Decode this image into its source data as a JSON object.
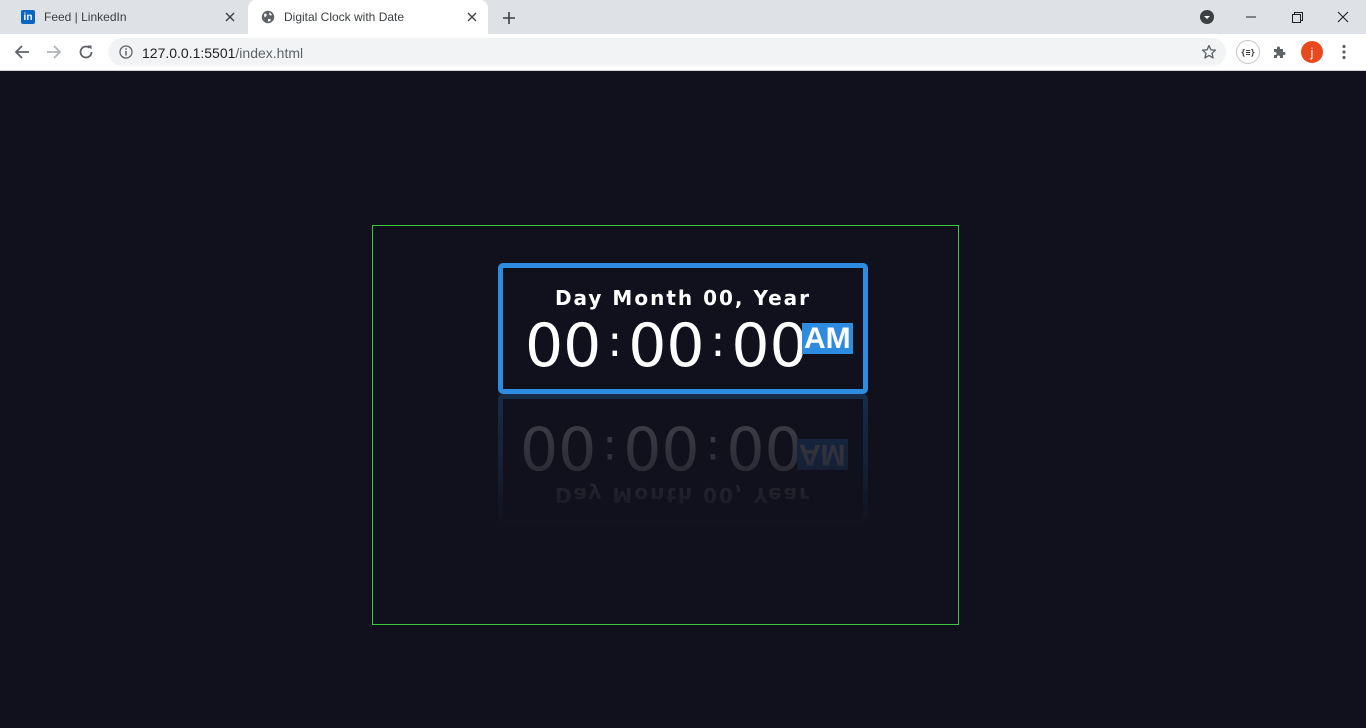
{
  "browser": {
    "tabs": [
      {
        "title": "Feed | LinkedIn",
        "icon": "linkedin-icon",
        "favicon_text": "in",
        "active": false
      },
      {
        "title": "Digital Clock with Date",
        "icon": "globe-icon",
        "active": true
      }
    ],
    "address": {
      "host": "127.0.0.1:5501",
      "path": "/index.html"
    },
    "extensions": {
      "json_label": "{≡}",
      "profile_initial": "j"
    }
  },
  "clock": {
    "date": "Day Month 00, Year",
    "hours": "00",
    "minutes": "00",
    "seconds": "00",
    "separator": ":",
    "period": "AM"
  },
  "colors": {
    "page_background": "#11111d",
    "accent": "#2d8ce0",
    "frame_border": "#3cc83c",
    "avatar": "#e8491d"
  }
}
